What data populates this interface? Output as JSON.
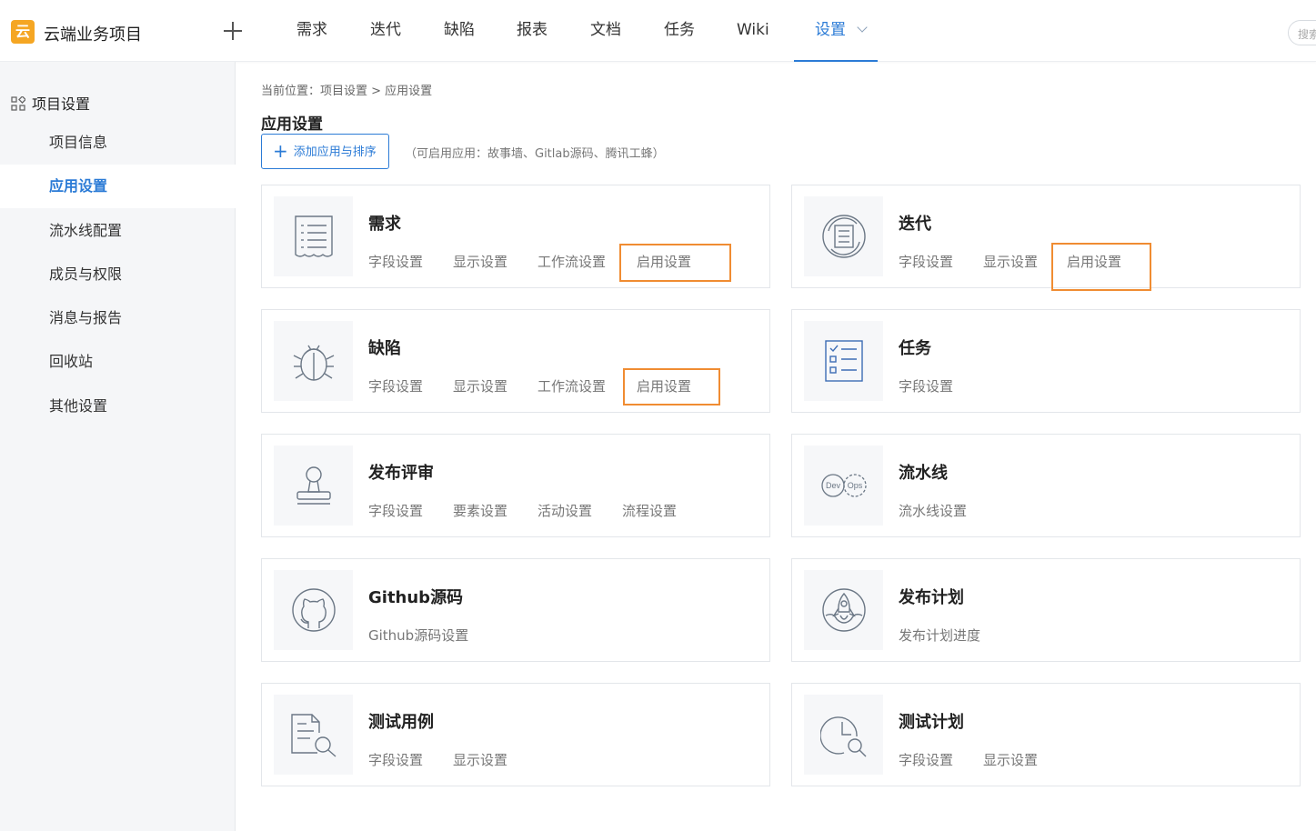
{
  "header": {
    "logo_char": "云",
    "project_name": "云端业务项目",
    "nav": [
      "需求",
      "迭代",
      "缺陷",
      "报表",
      "文档",
      "任务",
      "Wiki",
      "设置"
    ],
    "search_placeholder": "搜索"
  },
  "sidebar": {
    "heading": "项目设置",
    "items": [
      "项目信息",
      "应用设置",
      "流水线配置",
      "成员与权限",
      "消息与报告",
      "回收站",
      "其他设置"
    ],
    "active": "应用设置"
  },
  "main": {
    "breadcrumb": "当前位置：项目设置 > 应用设置",
    "title": "应用设置",
    "add_button": "添加应用与排序",
    "hint": "（可启用应用：故事墙、Gitlab源码、腾讯工蜂）",
    "cards": [
      {
        "title": "需求",
        "icon": "document-list-icon",
        "links": [
          "字段设置",
          "显示设置",
          "工作流设置",
          "启用设置"
        ]
      },
      {
        "title": "迭代",
        "icon": "iteration-cycle-icon",
        "links": [
          "字段设置",
          "显示设置",
          "启用设置"
        ]
      },
      {
        "title": "缺陷",
        "icon": "bug-icon",
        "links": [
          "字段设置",
          "显示设置",
          "工作流设置",
          "启用设置"
        ]
      },
      {
        "title": "任务",
        "icon": "checklist-icon",
        "links": [
          "字段设置"
        ]
      },
      {
        "title": "发布评审",
        "icon": "stamp-icon",
        "links": [
          "字段设置",
          "要素设置",
          "活动设置",
          "流程设置"
        ]
      },
      {
        "title": "流水线",
        "icon": "devops-icon",
        "links": [
          "流水线设置"
        ]
      },
      {
        "title": "Github源码",
        "icon": "github-icon",
        "links": [
          "Github源码设置"
        ]
      },
      {
        "title": "发布计划",
        "icon": "rocket-icon",
        "links": [
          "发布计划进度"
        ]
      },
      {
        "title": "测试用例",
        "icon": "test-case-icon",
        "links": [
          "字段设置",
          "显示设置"
        ]
      },
      {
        "title": "测试计划",
        "icon": "test-plan-icon",
        "links": [
          "字段设置",
          "显示设置"
        ]
      }
    ],
    "devops_labels": [
      "Dev",
      "Ops"
    ]
  },
  "colors": {
    "accent": "#2b7bd6",
    "highlight": "#f08c32",
    "logo": "#f5a623"
  }
}
